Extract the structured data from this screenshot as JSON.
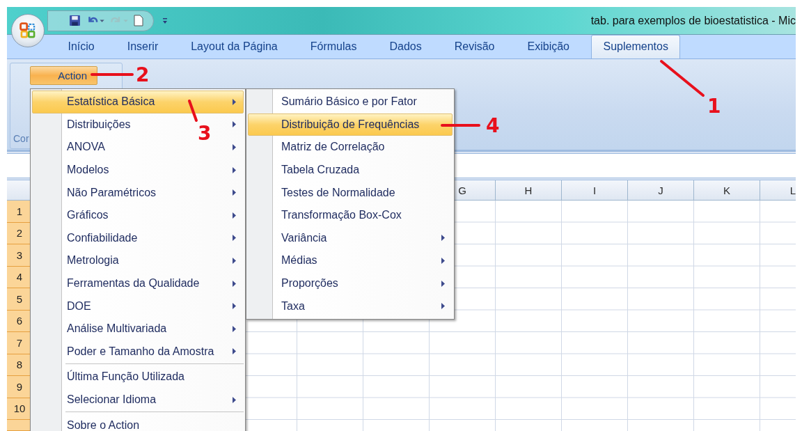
{
  "window": {
    "title": "tab. para exemplos de bioestatistica - Mic"
  },
  "quick_access": [
    {
      "kind": "save",
      "disabled": false
    },
    {
      "kind": "undo",
      "disabled": false
    },
    {
      "kind": "redo",
      "disabled": true
    },
    {
      "kind": "new",
      "disabled": false
    },
    {
      "kind": "customize",
      "disabled": false
    }
  ],
  "ribbon_tabs": [
    {
      "label": "Início",
      "selected": false
    },
    {
      "label": "Inserir",
      "selected": false
    },
    {
      "label": "Layout da Página",
      "selected": false
    },
    {
      "label": "Fórmulas",
      "selected": false
    },
    {
      "label": "Dados",
      "selected": false
    },
    {
      "label": "Revisão",
      "selected": false
    },
    {
      "label": "Exibição",
      "selected": false
    },
    {
      "label": "Suplementos",
      "selected": true
    }
  ],
  "ribbon": {
    "button": {
      "label": "Action",
      "pressed": true
    },
    "group_label": "Cor"
  },
  "sheet": {
    "columns": [
      "G",
      "H",
      "I",
      "J",
      "K",
      "L"
    ],
    "rows": [
      {
        "label": "1",
        "selected": true
      },
      {
        "label": "2",
        "selected": true
      },
      {
        "label": "3",
        "selected": true
      },
      {
        "label": "4",
        "selected": true
      },
      {
        "label": "5",
        "selected": true
      },
      {
        "label": "6",
        "selected": true
      },
      {
        "label": "7",
        "selected": true
      },
      {
        "label": "8",
        "selected": true
      },
      {
        "label": "9",
        "selected": true
      },
      {
        "label": "10",
        "selected": true
      }
    ]
  },
  "menu": {
    "items": [
      {
        "label": "Estatística Básica",
        "submenu": true,
        "selected": true,
        "separator_before": false
      },
      {
        "label": "Distribuições",
        "submenu": true,
        "selected": false,
        "separator_before": false
      },
      {
        "label": "ANOVA",
        "submenu": true,
        "selected": false,
        "separator_before": false
      },
      {
        "label": "Modelos",
        "submenu": true,
        "selected": false,
        "separator_before": false
      },
      {
        "label": "Não Paramétricos",
        "submenu": true,
        "selected": false,
        "separator_before": false
      },
      {
        "label": "Gráficos",
        "submenu": true,
        "selected": false,
        "separator_before": false
      },
      {
        "label": "Confiabilidade",
        "submenu": true,
        "selected": false,
        "separator_before": false
      },
      {
        "label": "Metrologia",
        "submenu": true,
        "selected": false,
        "separator_before": false
      },
      {
        "label": "Ferramentas da Qualidade",
        "submenu": true,
        "selected": false,
        "separator_before": false
      },
      {
        "label": "DOE",
        "submenu": true,
        "selected": false,
        "separator_before": false
      },
      {
        "label": "Análise Multivariada",
        "submenu": true,
        "selected": false,
        "separator_before": false
      },
      {
        "label": "Poder e Tamanho da Amostra",
        "submenu": true,
        "selected": false,
        "separator_before": false
      },
      {
        "label": "Última Função Utilizada",
        "submenu": false,
        "selected": false,
        "separator_before": true
      },
      {
        "label": "Selecionar Idioma",
        "submenu": true,
        "selected": false,
        "separator_before": false
      },
      {
        "label": "Sobre o Action",
        "submenu": false,
        "selected": false,
        "separator_before": true
      }
    ]
  },
  "submenu": {
    "items": [
      {
        "label": "Sumário Básico e por Fator",
        "submenu": false,
        "selected": false
      },
      {
        "label": "Distribuição de Frequências",
        "submenu": false,
        "selected": true
      },
      {
        "label": "Matriz de Correlação",
        "submenu": false,
        "selected": false
      },
      {
        "label": "Tabela Cruzada",
        "submenu": false,
        "selected": false
      },
      {
        "label": "Testes de Normalidade",
        "submenu": false,
        "selected": false
      },
      {
        "label": "Transformação Box-Cox",
        "submenu": false,
        "selected": false
      },
      {
        "label": "Variância",
        "submenu": true,
        "selected": false
      },
      {
        "label": "Médias",
        "submenu": true,
        "selected": false
      },
      {
        "label": "Proporções",
        "submenu": true,
        "selected": false
      },
      {
        "label": "Taxa",
        "submenu": true,
        "selected": false
      }
    ]
  },
  "annotations": [
    {
      "label": "1"
    },
    {
      "label": "2"
    },
    {
      "label": "3"
    },
    {
      "label": "4"
    }
  ]
}
